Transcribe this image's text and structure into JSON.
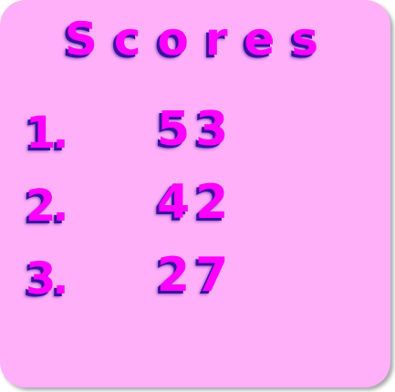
{
  "title": "Scores",
  "colors": {
    "background": "#ffb0f8",
    "text": "#ff00ff",
    "shadow": "#3a12a0"
  },
  "scores": [
    {
      "rank": "1.",
      "score": "53"
    },
    {
      "rank": "2.",
      "score": "42"
    },
    {
      "rank": "3.",
      "score": "27"
    }
  ]
}
